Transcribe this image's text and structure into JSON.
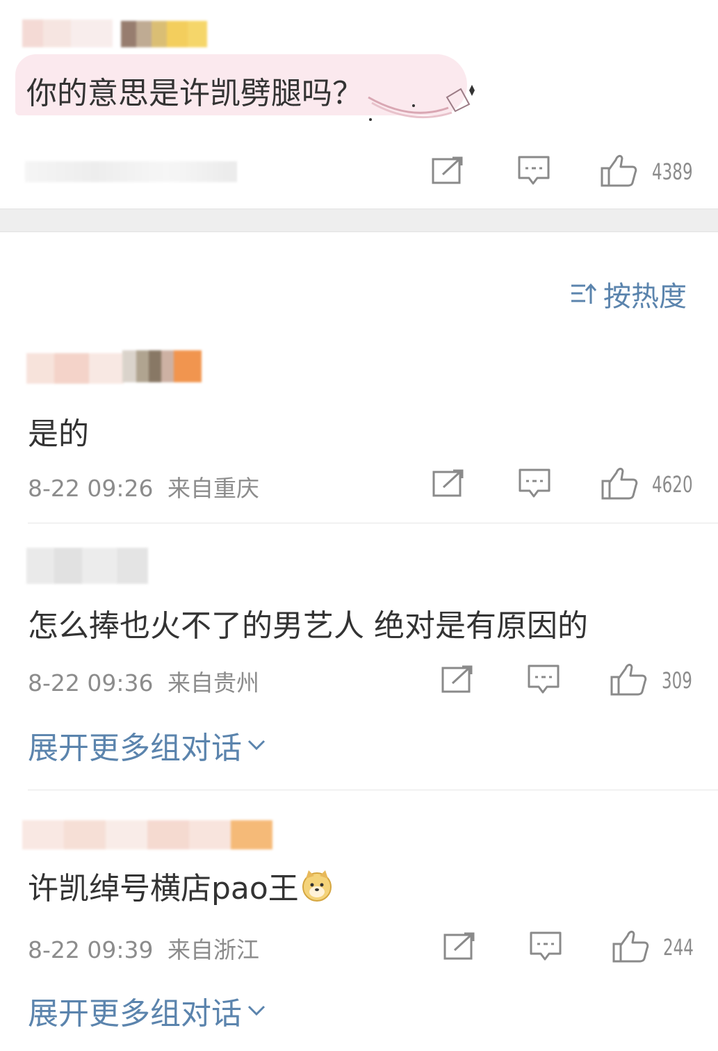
{
  "original_comment": {
    "text": "你的意思是许凯劈腿吗？",
    "like_count": "4389"
  },
  "sort": {
    "label": "按热度"
  },
  "comments": [
    {
      "text": "是的",
      "time": "8-22 09:26",
      "location": "来自重庆",
      "like_count": "4620"
    },
    {
      "text": "怎么捧也火不了的男艺人 绝对是有原因的",
      "time": "8-22 09:36",
      "location": "来自贵州",
      "like_count": "309",
      "expand_label": "展开更多组对话"
    },
    {
      "text": "许凯绰号横店pao王",
      "time": "8-22 09:39",
      "location": "来自浙江",
      "like_count": "244",
      "expand_label": "展开更多组对话"
    }
  ],
  "icons": {
    "share": "share-icon",
    "comment": "comment-icon",
    "like": "thumbs-up-icon",
    "sort": "sort-icon",
    "expand": "chevron-down-icon",
    "emoji": "doge-emoji-icon"
  },
  "colors": {
    "link": "#5b84ad",
    "meta": "#8c8c8c",
    "text": "#333333",
    "section_gap": "#eeeeee",
    "bubble": "#fbe9ee"
  }
}
